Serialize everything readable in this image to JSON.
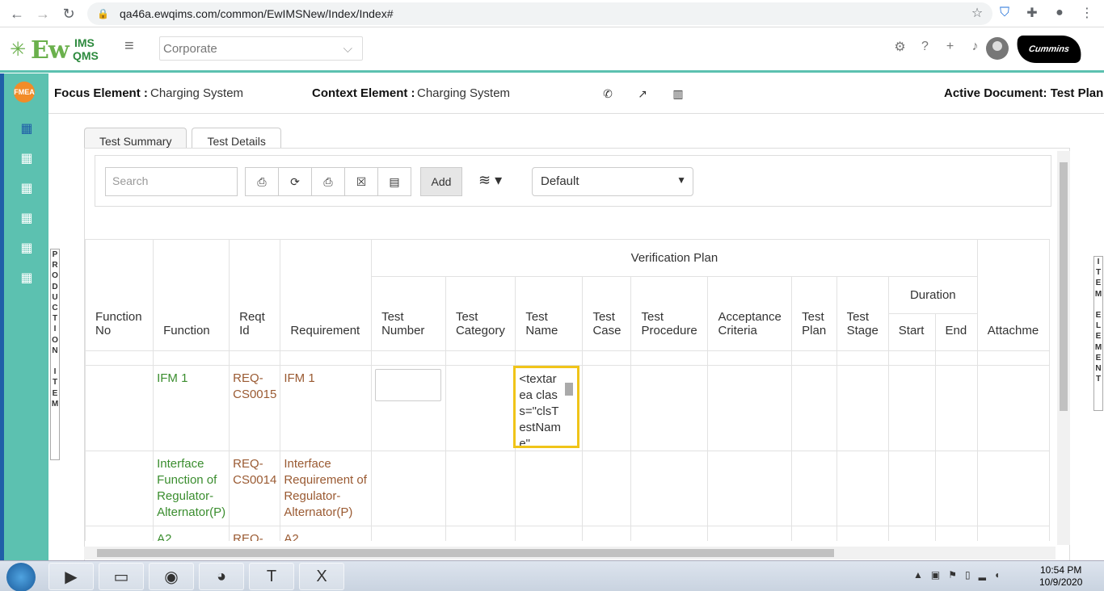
{
  "browser": {
    "url": "qa46a.ewqims.com/common/EwIMSNew/Index/Index#",
    "nav": {
      "back": "←",
      "forward": "→",
      "reload": "↻"
    },
    "icons": [
      "star-icon",
      "shield-icon",
      "extensions-icon",
      "profile-icon",
      "menu-icon"
    ]
  },
  "header": {
    "logo": {
      "ew": "Ew",
      "ims": "IMS",
      "qms": "QMS"
    },
    "corporate": "Corporate",
    "brand": "Cummins"
  },
  "sidebar": {
    "badge": "FMEA",
    "left_vertical": [
      "P",
      "R",
      "O",
      "D",
      "U",
      "C",
      "T",
      "I",
      "O",
      "N",
      "",
      "I",
      "T",
      "E",
      "M"
    ],
    "right_vertical": [
      "I",
      "T",
      "E",
      "M",
      "",
      "E",
      "L",
      "E",
      "M",
      "E",
      "N",
      "T"
    ]
  },
  "context": {
    "focus_label": "Focus Element :",
    "focus_value": "Charging System",
    "context_label": "Context Element :",
    "context_value": "Charging System",
    "active_doc": "Active Document: Test Plan"
  },
  "tabs": [
    {
      "label": "Test Summary"
    },
    {
      "label": "Test Details"
    }
  ],
  "toolbar": {
    "search_placeholder": "Search",
    "add": "Add",
    "view_select": "Default"
  },
  "table": {
    "headers": {
      "function_no": "Function No",
      "function": "Function",
      "reqt_id": "Reqt Id",
      "requirement": "Requirement",
      "verification_plan": "Verification Plan",
      "test_number": "Test Number",
      "test_category": "Test Category",
      "test_name": "Test Name",
      "test_case": "Test Case",
      "test_procedure": "Test Procedure",
      "acceptance_criteria": "Acceptance Criteria",
      "test_plan": "Test Plan",
      "test_stage": "Test Stage",
      "duration": "Duration",
      "start": "Start",
      "end": "End",
      "attachment": "Attachme"
    },
    "rows": [
      {
        "function": "IFM 1",
        "reqt_id": "REQ-CS0015",
        "requirement": "IFM 1",
        "test_name_text": "<textarea class=\"clsTestName\""
      },
      {
        "function": "Interface Function of Regulator-Alternator(P)",
        "reqt_id": "REQ-CS0014",
        "requirement": "Interface Requirement of Regulator-Alternator(P)"
      },
      {
        "function": "A2",
        "reqt_id": "REQ-",
        "requirement": "A2"
      }
    ]
  },
  "taskbar": {
    "time": "10:54 PM",
    "date": "10/9/2020"
  }
}
